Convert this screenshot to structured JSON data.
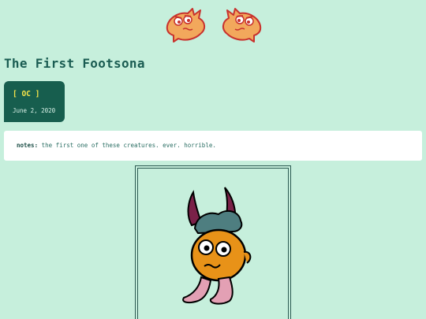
{
  "post": {
    "title": "The First Footsona",
    "tag": "[ OC ]",
    "date": "June 2, 2020",
    "notes_label": "notes:",
    "notes_text": " the first one of these creatures. ever. horrible."
  },
  "colors": {
    "background": "#c6efdc",
    "title": "#1a5c52",
    "card": "#175e4e",
    "tag": "#f5e44a"
  },
  "icons": {
    "header": "twin-fish-creature-logo",
    "artwork": "footsona-creature-drawing"
  }
}
